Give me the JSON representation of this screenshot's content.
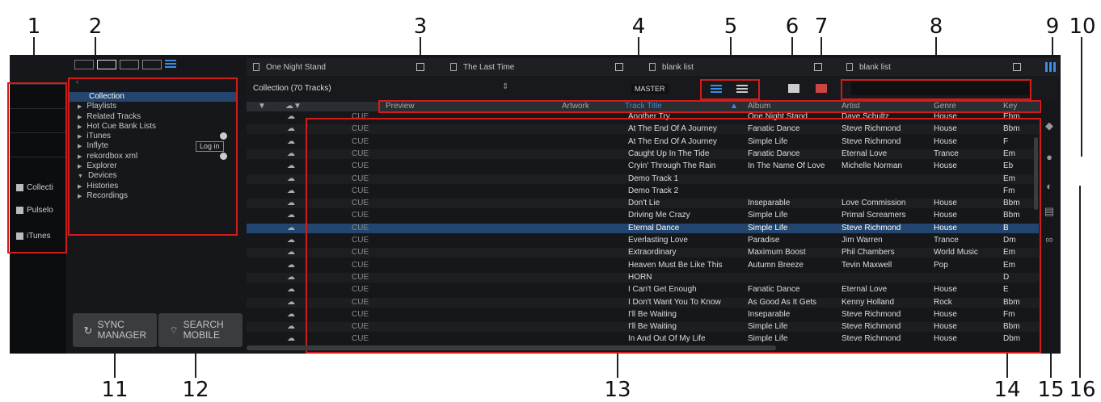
{
  "callouts": [
    "1",
    "2",
    "3",
    "4",
    "5",
    "6",
    "7",
    "8",
    "9",
    "10",
    "11",
    "12",
    "13",
    "14",
    "15",
    "16"
  ],
  "leftpanel": {
    "items": [
      {
        "label": "Collecti",
        "icon": "document-icon"
      },
      {
        "label": "Pulselo",
        "icon": "info-icon"
      },
      {
        "label": "iTunes",
        "icon": "folder-icon"
      }
    ]
  },
  "tree": {
    "items": [
      {
        "label": "Collection",
        "arrow": "",
        "selected": true
      },
      {
        "label": "Playlists",
        "arrow": "▶"
      },
      {
        "label": "Related Tracks",
        "arrow": "▶"
      },
      {
        "label": "Hot Cue Bank Lists",
        "arrow": "▶"
      },
      {
        "label": "iTunes",
        "arrow": "▶"
      },
      {
        "label": "Inflyte",
        "arrow": "▶"
      },
      {
        "label": "rekordbox xml",
        "arrow": "▶"
      },
      {
        "label": "Explorer",
        "arrow": "▶"
      },
      {
        "label": "Devices",
        "arrow": "▼"
      },
      {
        "label": "Histories",
        "arrow": "▶"
      },
      {
        "label": "Recordings",
        "arrow": "▶"
      }
    ],
    "login_label": "Log in"
  },
  "buttons": {
    "sync": "SYNC MANAGER",
    "search": "SEARCH MOBILE"
  },
  "tabs": [
    "One Night Stand",
    "The Last Time",
    "blank list",
    "blank list"
  ],
  "toolbar": {
    "collection_title": "Collection (70 Tracks)",
    "master": "MASTER"
  },
  "columns": {
    "preview": "Preview",
    "artwork": "Artwork",
    "title": "Track Title",
    "album": "Album",
    "artist": "Artist",
    "genre": "Genre",
    "key": "Key"
  },
  "cue_label": "CUE",
  "tracks": [
    {
      "title": "Another Try",
      "album": "One Night Stand",
      "artist": "Dave Schultz",
      "genre": "House",
      "key": "Ebm",
      "art": "#555"
    },
    {
      "title": "At The End Of A Journey",
      "album": "Fanatic Dance",
      "artist": "Steve Richmond",
      "genre": "House",
      "key": "Bbm",
      "art": "#2a2a2a"
    },
    {
      "title": "At The End Of A Journey",
      "album": "Simple Life",
      "artist": "Steve Richmond",
      "genre": "House",
      "key": "F",
      "art": "#2f9a6a"
    },
    {
      "title": "Caught Up In The Tide",
      "album": "Fanatic Dance",
      "artist": "Eternal Love",
      "genre": "Trance",
      "key": "Em",
      "art": "#333"
    },
    {
      "title": "Cryin' Through The Rain",
      "album": "In The Name Of Love",
      "artist": "Michelle Norman",
      "genre": "House",
      "key": "Eb",
      "art": "#3c8a2a"
    },
    {
      "title": "Demo Track 1",
      "album": "",
      "artist": "",
      "genre": "",
      "key": "Em",
      "art": "#2a2a2a"
    },
    {
      "title": "Demo Track 2",
      "album": "",
      "artist": "",
      "genre": "",
      "key": "Fm",
      "art": "#444"
    },
    {
      "title": "Don't Lie",
      "album": "Inseparable",
      "artist": "Love Commission",
      "genre": "House",
      "key": "Bbm",
      "art": "#8a4a9a"
    },
    {
      "title": "Driving Me Crazy",
      "album": "Simple Life",
      "artist": "Primal Screamers",
      "genre": "House",
      "key": "Bbm",
      "art": "#2f9a6a"
    },
    {
      "title": "Eternal Dance",
      "album": "Simple Life",
      "artist": "Steve Richmond",
      "genre": "House",
      "key": "B",
      "art": "#2f9a6a"
    },
    {
      "title": "Everlasting Love",
      "album": "Paradise",
      "artist": "Jim Warren",
      "genre": "Trance",
      "key": "Dm",
      "art": "#2a4aa0"
    },
    {
      "title": "Extraordinary",
      "album": "Maximum Boost",
      "artist": "Phil Chambers",
      "genre": "World Music",
      "key": "Em",
      "art": "#c05020"
    },
    {
      "title": "Heaven Must Be Like This",
      "album": "Autumn Breeze",
      "artist": "Tevin Maxwell",
      "genre": "Pop",
      "key": "Em",
      "art": "#d07020"
    },
    {
      "title": "HORN",
      "album": "",
      "artist": "",
      "genre": "",
      "key": "D",
      "art": "#2a2a2a"
    },
    {
      "title": "I Can't Get Enough",
      "album": "Fanatic Dance",
      "artist": "Eternal Love",
      "genre": "House",
      "key": "E",
      "art": "#555"
    },
    {
      "title": "I Don't Want You To Know",
      "album": "As Good As It Gets",
      "artist": "Kenny Holland",
      "genre": "Rock",
      "key": "Bbm",
      "art": "#a04020"
    },
    {
      "title": "I'll Be Waiting",
      "album": "Inseparable",
      "artist": "Steve Richmond",
      "genre": "House",
      "key": "Fm",
      "art": "#8a4a9a"
    },
    {
      "title": "I'll Be Waiting",
      "album": "Simple Life",
      "artist": "Steve Richmond",
      "genre": "House",
      "key": "Bbm",
      "art": "#2f9a6a"
    },
    {
      "title": "In And Out Of My Life",
      "album": "Simple Life",
      "artist": "Steve Richmond",
      "genre": "House",
      "key": "Dbm",
      "art": "#2f9a6a"
    }
  ],
  "colors": {
    "accent": "#3a8ee6",
    "highlight_red": "#d41b1b",
    "selected_row": "#22466f"
  }
}
